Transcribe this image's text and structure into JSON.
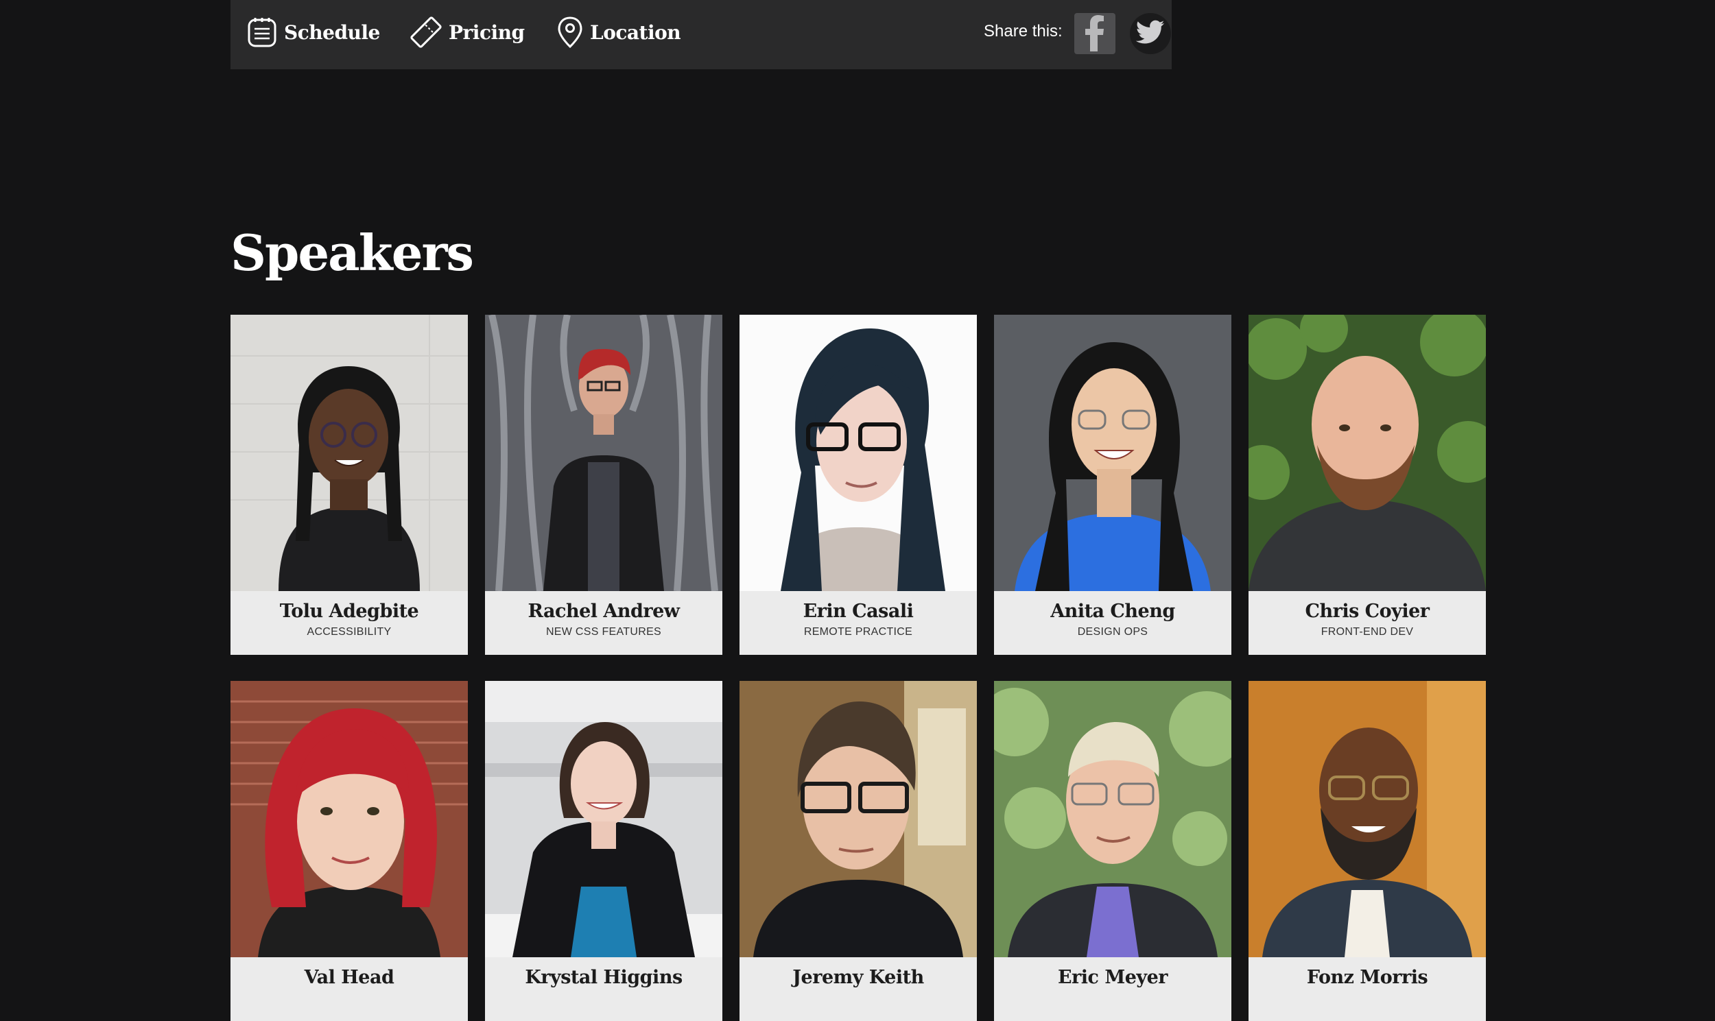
{
  "nav": {
    "items": [
      {
        "label": "Schedule",
        "icon": "schedule-icon"
      },
      {
        "label": "Pricing",
        "icon": "ticket-icon"
      },
      {
        "label": "Location",
        "icon": "map-pin-icon"
      }
    ],
    "share_label": "Share this:",
    "share_icons": [
      "facebook-icon",
      "twitter-icon"
    ]
  },
  "speakers": {
    "title": "Speakers",
    "items": [
      {
        "name": "Tolu Adegbite",
        "topic": "ACCESSIBILITY"
      },
      {
        "name": "Rachel Andrew",
        "topic": "NEW CSS FEATURES"
      },
      {
        "name": "Erin Casali",
        "topic": "REMOTE PRACTICE"
      },
      {
        "name": "Anita Cheng",
        "topic": "DESIGN OPS"
      },
      {
        "name": "Chris Coyier",
        "topic": "FRONT-END DEV"
      },
      {
        "name": "Val Head",
        "topic": ""
      },
      {
        "name": "Krystal Higgins",
        "topic": ""
      },
      {
        "name": "Jeremy Keith",
        "topic": ""
      },
      {
        "name": "Eric Meyer",
        "topic": ""
      },
      {
        "name": "Fonz Morris",
        "topic": ""
      }
    ]
  },
  "colors": {
    "page_bg": "#141415",
    "nav_bg": "#2a2a2b",
    "caption_bg": "#ebebeb",
    "text": "#ffffff"
  }
}
